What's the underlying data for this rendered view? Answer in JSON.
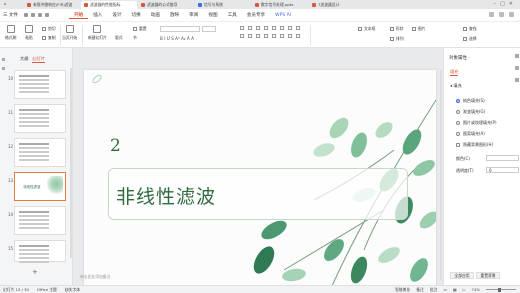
{
  "tabs": [
    {
      "label": "首页",
      "color": "#d9573c"
    },
    {
      "label": "有限冲激响应(FIR)滤波",
      "color": "#d9573c"
    },
    {
      "label": "滤波器的性能指标",
      "color": "#d9573c"
    },
    {
      "label": "滤波器的公式推导",
      "color": "#d9573c"
    },
    {
      "label": "信号与系统",
      "color": "#3b6fe6"
    },
    {
      "label": "数字信号处理.pptx",
      "color": "#d9573c"
    },
    {
      "label": "7滤波器设计",
      "color": "#d9573c"
    }
  ],
  "menu": {
    "file": "三 文件",
    "items": [
      "开始",
      "插入",
      "设计",
      "切换",
      "动画",
      "放映",
      "审阅",
      "视图",
      "工具",
      "会员专享"
    ],
    "active": "开始",
    "ai": "WPS AI"
  },
  "ribbon": {
    "format_painter": "格式刷",
    "paste": "粘贴",
    "cut": "剪切",
    "copy": "复制",
    "from_current": "当页开始",
    "new_slide": "新建幻灯片",
    "layout": "版式",
    "section": "节",
    "reset": "重置",
    "format_row": "B  I  U  S  A²  A₂  A  A",
    "textbox": "文本框",
    "shape": "形状",
    "picture": "图片",
    "arrange": "排列",
    "find": "查找",
    "select": "选择"
  },
  "left_panel": {
    "tabs": [
      "大纲",
      "幻灯片"
    ],
    "active_tab": "幻灯片",
    "slides": [
      {
        "num": "10",
        "type": "text"
      },
      {
        "num": "11",
        "type": "text"
      },
      {
        "num": "12",
        "type": "text"
      },
      {
        "num": "13",
        "type": "title",
        "title": "非线性滤波"
      },
      {
        "num": "14",
        "type": "text"
      },
      {
        "num": "15",
        "type": "text"
      }
    ],
    "selected": "13",
    "add": "+"
  },
  "slide": {
    "number": "2",
    "title": "非线性滤波",
    "notes_placeholder": "单击此处添加备注"
  },
  "right_panel": {
    "title": "对象属性 ·",
    "tab": "填充",
    "section": "◂ 填充",
    "options": [
      "纯色填充(S)",
      "渐变填充(G)",
      "图片或纹理填充(P)",
      "图案填充(A)",
      "隐藏背景图形(H)"
    ],
    "selected_option": "纯色填充(S)",
    "color_label": "颜色(C)",
    "transparency_label": "透明度(T)",
    "transparency_value": "0",
    "apply_all": "全部应用",
    "reset_bg": "重置背景"
  },
  "status": {
    "slide": "幻灯片 13 / 30",
    "theme": "Office 主题",
    "font": "缺失字体",
    "smart": "智能美化",
    "notes": "备注",
    "comments": "批注",
    "zoom": "74%",
    "zoom_level": 0.74
  }
}
